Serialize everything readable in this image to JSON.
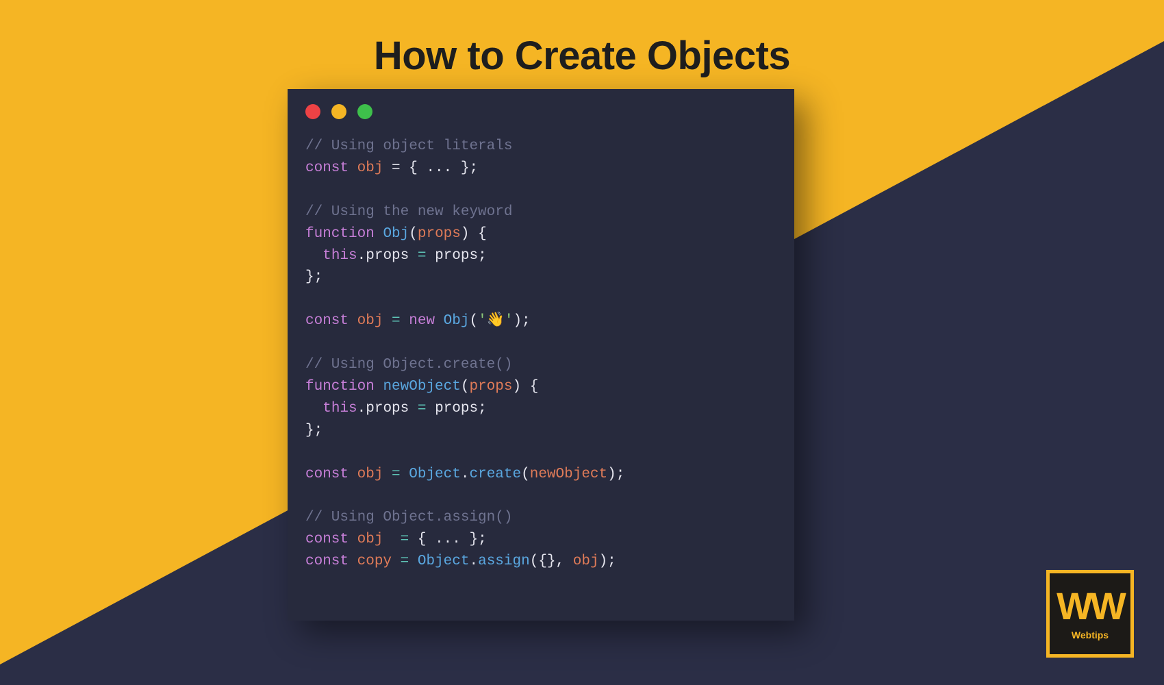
{
  "title": "How to Create Objects",
  "logo": {
    "mark": "WW",
    "sub": "Webtips"
  },
  "traffic": {
    "red": "close-icon",
    "yellow": "minimize-icon",
    "green": "maximize-icon"
  },
  "code": {
    "c1": "// Using object literals",
    "l1_kw": "const",
    "l1_var": "obj",
    "l1_rest": " = { ... };",
    "c2": "// Using the new keyword",
    "l2_kw": "function",
    "l2_fn": "Obj",
    "l2_p": "props",
    "l3_this": "this",
    "l3_prop": ".props",
    "l3_eq": " = ",
    "l3_rhs": "props",
    "l3_end": ";",
    "l4_kw": "const",
    "l4_var": "obj",
    "l4_eq": " = ",
    "l4_new": "new",
    "l4_fn": "Obj",
    "l4_str": "'👋'",
    "c3": "// Using Object.create()",
    "l5_kw": "function",
    "l5_fn": "newObject",
    "l5_p": "props",
    "l6_this": "this",
    "l6_prop": ".props",
    "l6_eq": " = ",
    "l6_rhs": "props",
    "l6_end": ";",
    "l7_kw": "const",
    "l7_var": "obj",
    "l7_eq": " = ",
    "l7_obj": "Object",
    "l7_dot": ".",
    "l7_m": "create",
    "l7_arg": "newObject",
    "c4": "// Using Object.assign()",
    "l8_kw": "const",
    "l8_var": "obj",
    "l8_pad": "  ",
    "l8_eq": "= ",
    "l8_rest": "{ ... };",
    "l9_kw": "const",
    "l9_var": "copy",
    "l9_eq": " = ",
    "l9_obj": "Object",
    "l9_dot": ".",
    "l9_m": "assign",
    "l9_a1": "{}",
    "l9_sep": ", ",
    "l9_a2": "obj"
  }
}
